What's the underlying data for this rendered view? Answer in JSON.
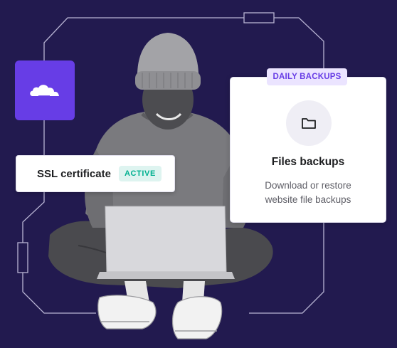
{
  "colors": {
    "background": "#221a4f",
    "brand_purple": "#673de6",
    "badge_green_text": "#00b090",
    "badge_green_bg": "#def4f0",
    "badge_purple_bg": "#ebe4ff"
  },
  "logo_tile": {
    "icon": "cloudflare-cloud-icon"
  },
  "ssl_card": {
    "title": "SSL certificate",
    "status": "ACTIVE"
  },
  "backup_card": {
    "badge": "DAILY BACKUPS",
    "icon": "folder-icon",
    "title": "Files backups",
    "description_line1": "Download or restore",
    "description_line2": "website file backups"
  },
  "illustration": {
    "subject": "person-with-laptop-illustration"
  }
}
